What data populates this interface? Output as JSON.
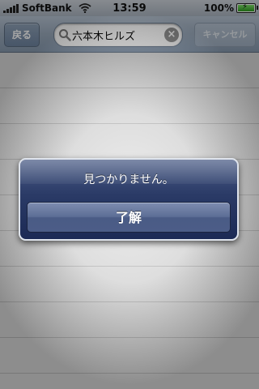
{
  "status_bar": {
    "carrier": "SoftBank",
    "time": "13:59",
    "battery_percent": "100%",
    "battery_level": 1.0,
    "signal_bars": 5,
    "icons": [
      "signal-icon",
      "wifi-icon",
      "battery-icon",
      "charging-bolt-icon"
    ]
  },
  "search_bar": {
    "back_label": "戻る",
    "search_value": "六本木ヒルズ",
    "cancel_label": "キャンセル",
    "icons": [
      "search-icon",
      "clear-icon"
    ]
  },
  "alert": {
    "message": "見つかりません。",
    "ok_label": "了解"
  },
  "colors": {
    "alert_background": "#2a3a66",
    "alert_border": "#dfe4ec",
    "navbar": "#9aaabc",
    "battery_green": "#2e9b1f"
  }
}
